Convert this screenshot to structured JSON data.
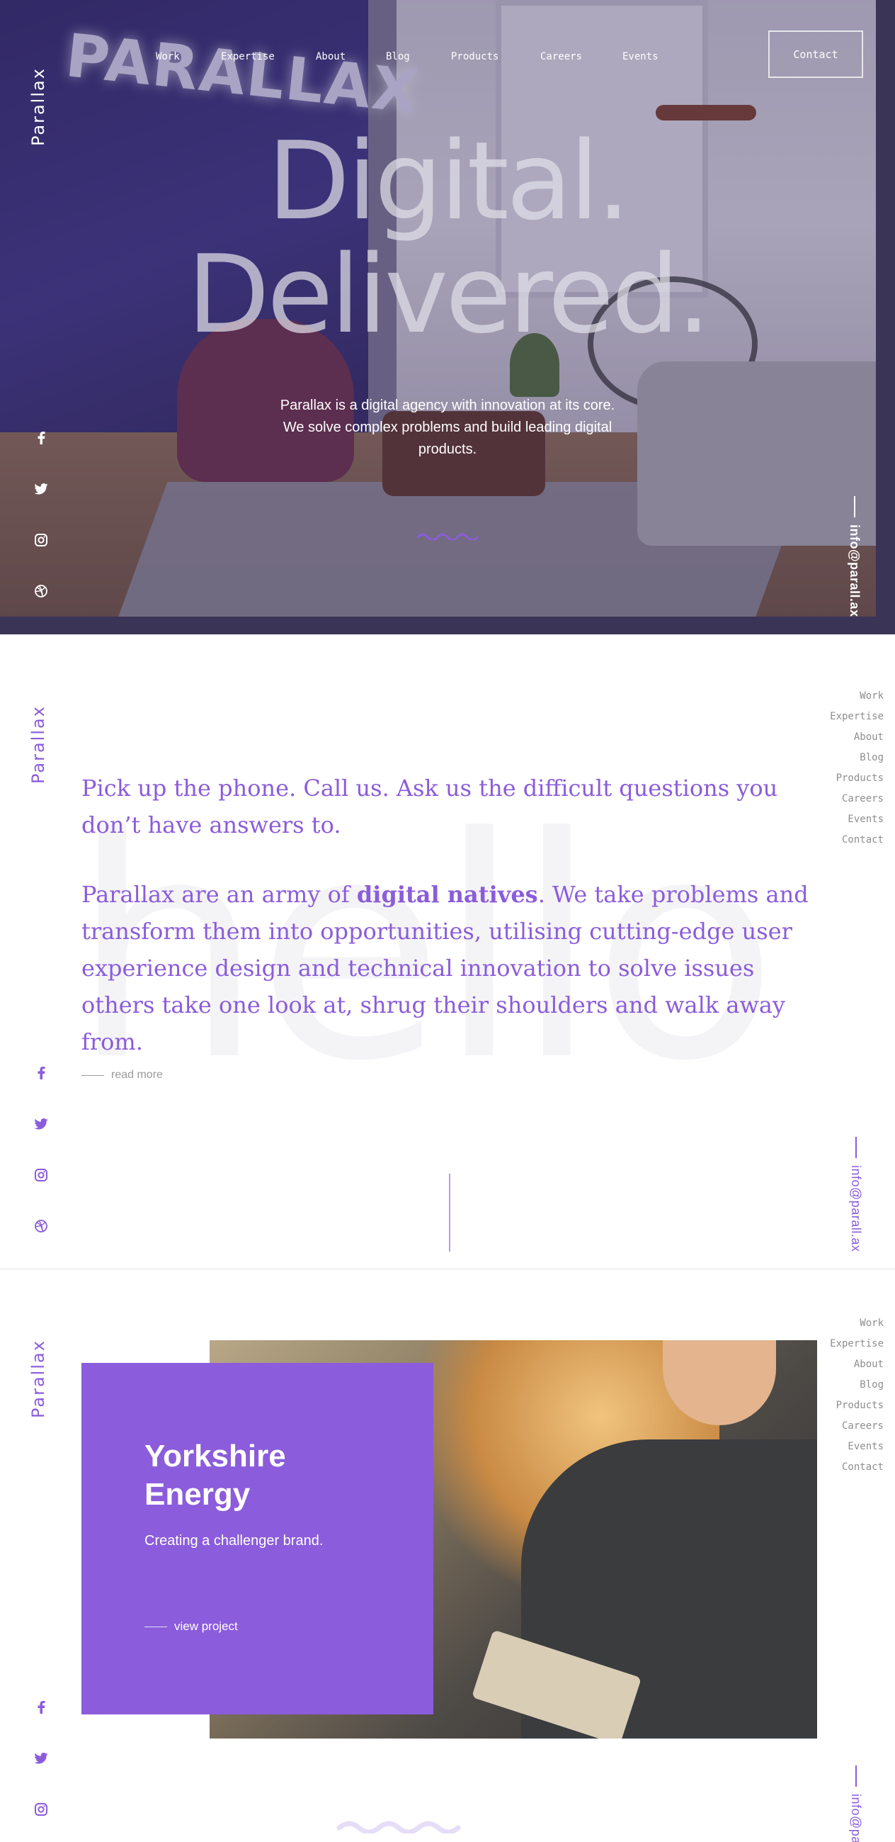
{
  "brand": "Parallax",
  "colors": {
    "accent": "#8b5cdb",
    "hero_overlay": "#3a3457",
    "nav_gray": "#8e8e8e"
  },
  "hero": {
    "sign_text": "PARALLAX",
    "nav": [
      "Work",
      "Expertise",
      "About",
      "Blog",
      "Products",
      "Careers",
      "Events"
    ],
    "contact_label": "Contact",
    "headline_line1": "Digital.",
    "headline_line2": "Delivered.",
    "subtext": "Parallax is a digital agency with innovation at its core. We solve complex problems and build leading digital products.",
    "email": "info@parall.ax",
    "social_icons": [
      "facebook-icon",
      "twitter-icon",
      "instagram-icon",
      "dribbble-icon"
    ]
  },
  "intro": {
    "side_nav": [
      "Work",
      "Expertise",
      "About",
      "Blog",
      "Products",
      "Careers",
      "Events",
      "Contact"
    ],
    "background_word": "hello",
    "paragraph1": "Pick up the phone. Call us. Ask us the difficult questions you don’t have answers to.",
    "paragraph2_before": "Parallax are an army of ",
    "paragraph2_bold": "digital natives",
    "paragraph2_after": ". We take problems and transform them into opportunities, utilising cutting-edge user experience design and technical innovation to solve issues others take one look at, shrug their shoulders and walk away from.",
    "read_more": "read more",
    "email": "info@parall.ax"
  },
  "project": {
    "side_nav": [
      "Work",
      "Expertise",
      "About",
      "Blog",
      "Products",
      "Careers",
      "Events",
      "Contact"
    ],
    "title_line1": "Yorkshire",
    "title_line2": "Energy",
    "subtitle": "Creating a challenger brand.",
    "link_label": "view project",
    "email": "info@pa"
  }
}
